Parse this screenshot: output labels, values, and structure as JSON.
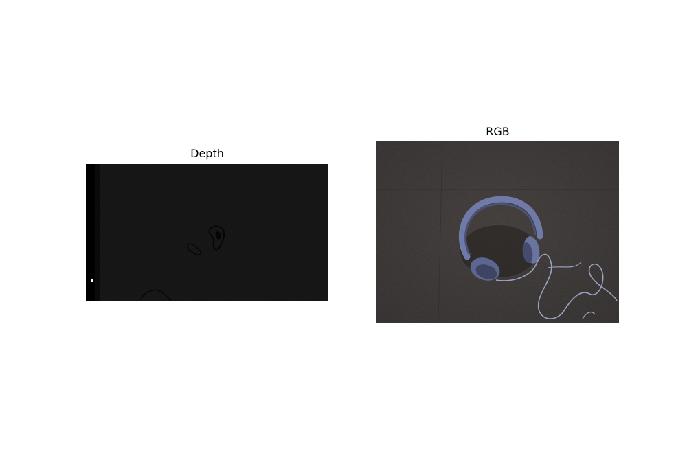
{
  "figure": {
    "panels": [
      {
        "title": "Depth",
        "image": "depth-map-of-headphones-on-floor",
        "colormap": "grayscale"
      },
      {
        "title": "RGB",
        "image": "photo-of-headphones-on-floor",
        "colors": {
          "floor": "#34302c",
          "headphones": "#6f7aa8"
        }
      }
    ]
  }
}
